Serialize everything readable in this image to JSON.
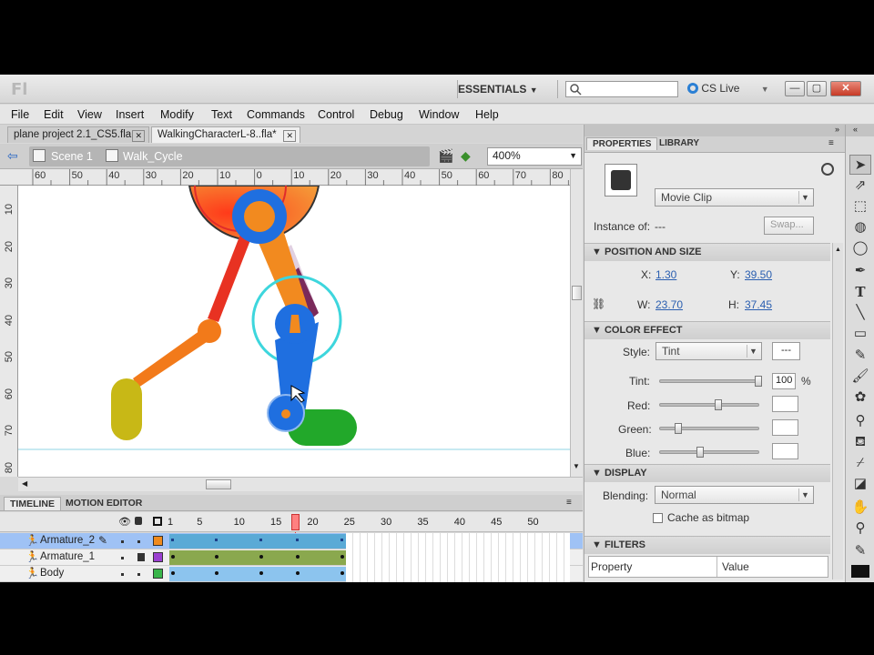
{
  "app": {
    "logo": "Fl",
    "workspace": "ESSENTIALS",
    "cs_live": "CS Live",
    "window_buttons": {
      "minimize": "—",
      "restore": "▢",
      "close": "✕"
    }
  },
  "menu": [
    "File",
    "Edit",
    "View",
    "Insert",
    "Modify",
    "Text",
    "Commands",
    "Control",
    "Debug",
    "Window",
    "Help"
  ],
  "doc_tabs": [
    {
      "label": "plane project 2.1_CS5.fla",
      "active": false
    },
    {
      "label": "WalkingCharacterL-8..fla*",
      "active": true
    }
  ],
  "edit_bar": {
    "scene": "Scene 1",
    "symbol": "Walk_Cycle",
    "zoom": "400%"
  },
  "rulers": {
    "horizontal": [
      "60",
      "50",
      "40",
      "30",
      "20",
      "10",
      "0",
      "10",
      "20",
      "30",
      "40",
      "50",
      "60",
      "70",
      "80"
    ],
    "vertical": [
      "10",
      "20",
      "30",
      "40",
      "50",
      "60",
      "70",
      "80"
    ]
  },
  "timeline": {
    "tabs": [
      "TIMELINE",
      "MOTION EDITOR"
    ],
    "frame_numbers": [
      "1",
      "5",
      "10",
      "15",
      "20",
      "25",
      "30",
      "35",
      "40",
      "45",
      "50"
    ],
    "current_frame": 18,
    "layers": [
      {
        "name": "Armature_2",
        "color": "#f08a1c",
        "selected": true
      },
      {
        "name": "Armature_1",
        "color": "#9a3fd0",
        "selected": false
      },
      {
        "name": "Body",
        "color": "#39b54a",
        "selected": false
      }
    ]
  },
  "panel": {
    "tabs": [
      "PROPERTIES",
      "LIBRARY"
    ],
    "symbol_type": "Movie Clip",
    "instance_of_label": "Instance of:",
    "instance_of_value": "---",
    "swap_label": "Swap...",
    "position_size": {
      "header": "POSITION AND SIZE",
      "x_label": "X:",
      "x": "1.30",
      "y_label": "Y:",
      "y": "39.50",
      "w_label": "W:",
      "w": "23.70",
      "h_label": "H:",
      "h": "37.45"
    },
    "color_effect": {
      "header": "COLOR EFFECT",
      "style_label": "Style:",
      "style": "Tint",
      "tint_swatch": "---",
      "tint_label": "Tint:",
      "tint_value": "100",
      "tint_unit": "%",
      "red_label": "Red:",
      "green_label": "Green:",
      "blue_label": "Blue:"
    },
    "display": {
      "header": "DISPLAY",
      "blending_label": "Blending:",
      "blending": "Normal",
      "cache_label": "Cache as bitmap"
    },
    "filters": {
      "header": "FILTERS",
      "col_property": "Property",
      "col_value": "Value"
    }
  },
  "tools": [
    "selection-icon",
    "subselection-icon",
    "free-transform-icon",
    "3d-rotation-icon",
    "lasso-icon",
    "pen-icon",
    "text-icon",
    "line-icon",
    "rectangle-icon",
    "pencil-icon",
    "brush-icon",
    "deco-icon",
    "bone-icon",
    "paint-bucket-icon",
    "eyedropper-icon",
    "eraser-icon",
    "hand-icon",
    "zoom-icon",
    "stroke-color-icon",
    "fill-color-icon"
  ]
}
